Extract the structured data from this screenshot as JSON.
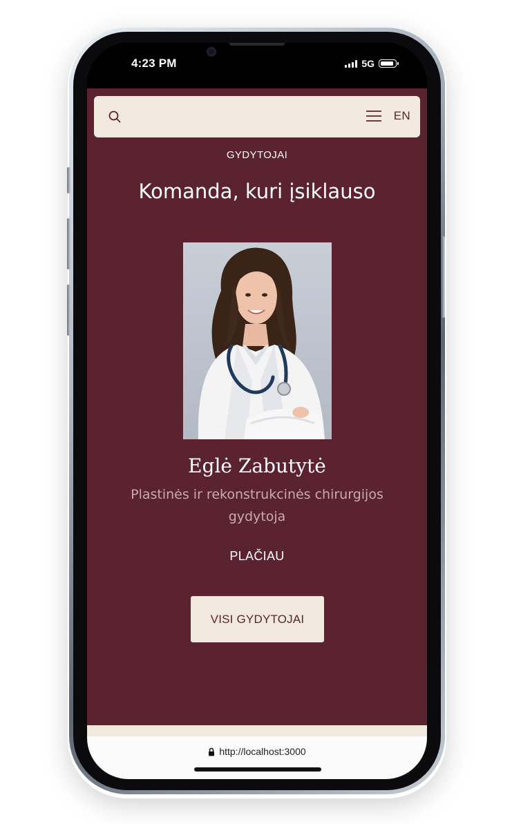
{
  "status": {
    "time": "4:23 PM",
    "network": "5G",
    "battery_level": 0.9
  },
  "header": {
    "search_icon": "search-icon",
    "menu_icon": "hamburger-menu-icon",
    "language": "EN"
  },
  "section": {
    "eyebrow": "GYDYTOJAI",
    "title": "Komanda, kuri įsiklauso"
  },
  "doctor": {
    "name": "Eglė Zabutytė",
    "role": "Plastinės ir rekonstrukcinės chirurgijos gydytoja",
    "more_label": "PLAČIAU"
  },
  "cta": {
    "all_doctors_label": "VISI GYDYTOJAI"
  },
  "browser": {
    "url": "http://localhost:3000",
    "lock_icon": "lock-icon"
  },
  "colors": {
    "background": "#5b2230",
    "accent_light": "#f1e8de",
    "role_text": "#c9aab2"
  }
}
